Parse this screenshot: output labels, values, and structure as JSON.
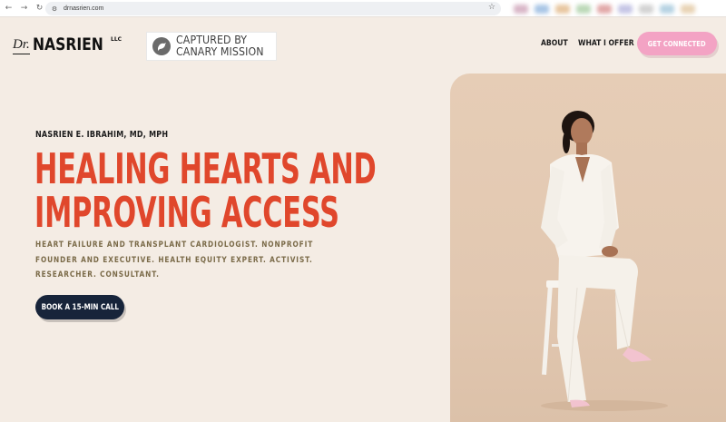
{
  "browser": {
    "url": "drnasrien.com",
    "icons": {
      "back": "arrow-left-icon",
      "forward": "arrow-right-icon",
      "reload": "reload-icon",
      "site_info": "site-settings-icon",
      "bookmark": "star-icon"
    }
  },
  "header": {
    "logo": {
      "prefix": "Dr.",
      "name": "NASRIEN",
      "suffix": "LLC"
    },
    "badge": {
      "line1": "CAPTURED BY",
      "line2": "CANARY MISSION",
      "icon": "canary-bird-icon"
    },
    "nav": [
      {
        "label": "ABOUT"
      },
      {
        "label": "WHAT I OFFER"
      }
    ],
    "cta_label": "GET CONNECTED"
  },
  "hero": {
    "subtitle": "NASRIEN E. IBRAHIM, MD, MPH",
    "headline_line1": "HEALING HEARTS AND",
    "headline_line2": "IMPROVING ACCESS",
    "tagline_line1": "HEART FAILURE AND TRANSPLANT CARDIOLOGIST. NONPROFIT",
    "tagline_line2": "FOUNDER AND EXECUTIVE. HEALTH EQUITY EXPERT. ACTIVIST.",
    "tagline_line3": "RESEARCHER. CONSULTANT.",
    "cta_label": "BOOK A 15-MIN CALL"
  },
  "colors": {
    "page_bg": "#f4ece4",
    "headline": "#e0472c",
    "tagline": "#7a6a48",
    "cta_dark": "#17243a",
    "cta_pink": "#f3a3c4",
    "photo_bg": "#e2c8b1"
  }
}
